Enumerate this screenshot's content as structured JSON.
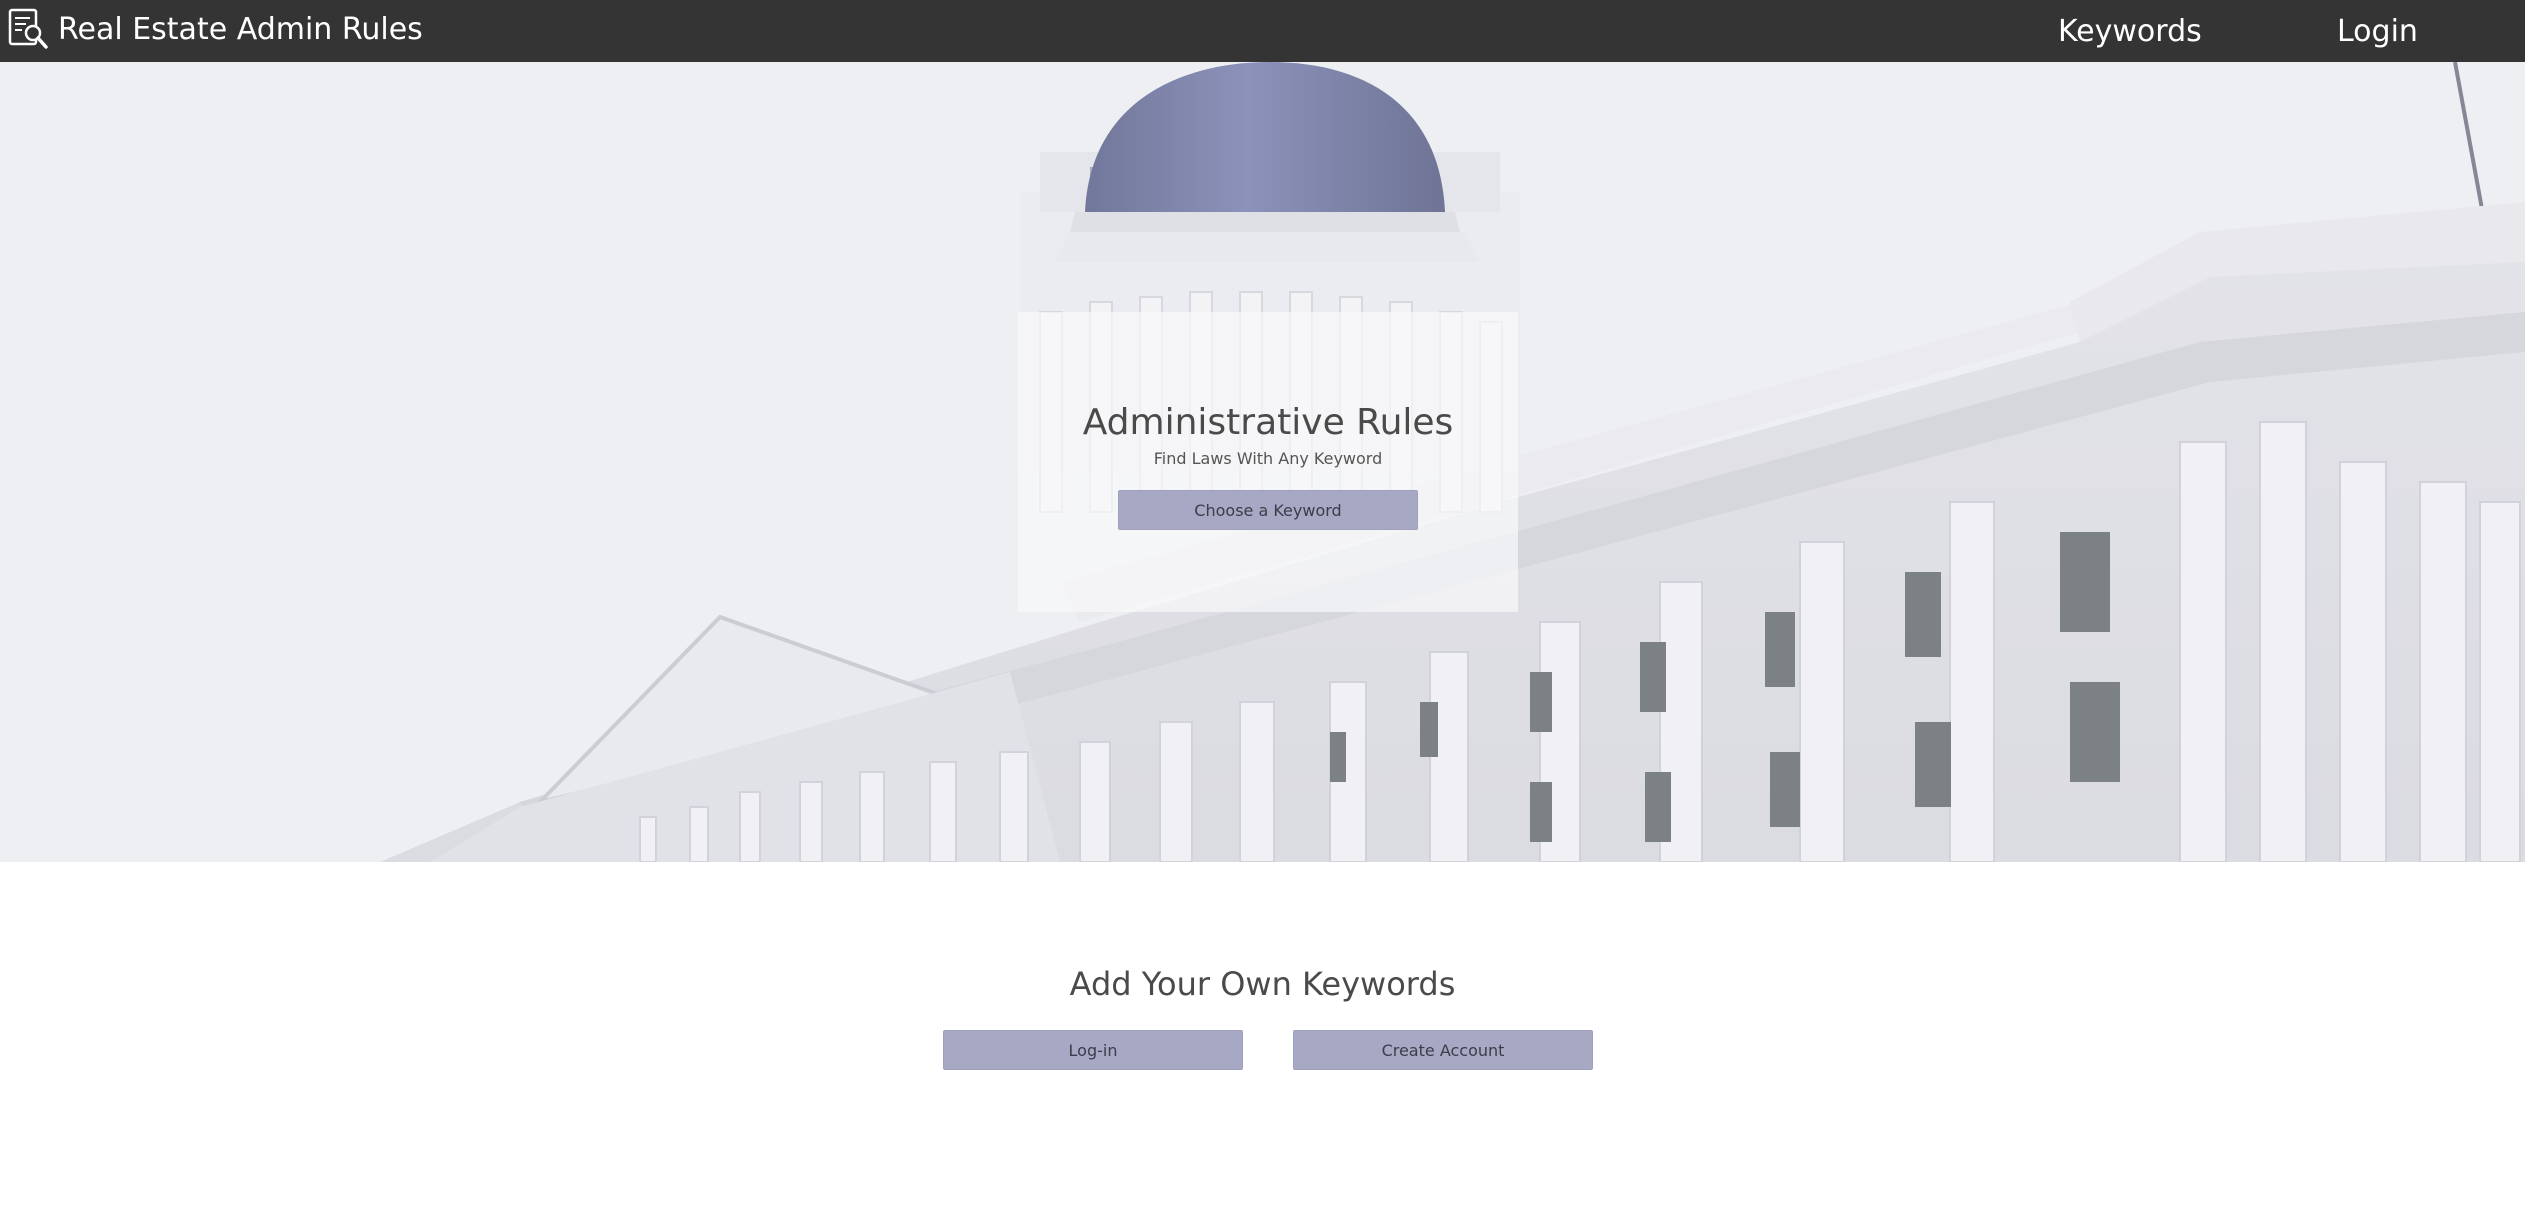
{
  "navbar": {
    "logo_icon": "document-search-icon",
    "brand_title": "Real Estate Admin Rules",
    "links": {
      "keywords": "Keywords",
      "login": "Login"
    }
  },
  "hero": {
    "background_image": "state-capitol-building",
    "title": "Administrative Rules",
    "subtitle": "Find Laws With Any Keyword",
    "button_label": "Choose a Keyword"
  },
  "keywords_section": {
    "title": "Add Your Own Keywords",
    "login_button": "Log-in",
    "create_account_button": "Create Account"
  },
  "colors": {
    "navbar_bg": "#343434",
    "button_bg": "#a7a8c4",
    "text_dark": "#4a4a4a",
    "dome_blue": "#3f4a82"
  }
}
